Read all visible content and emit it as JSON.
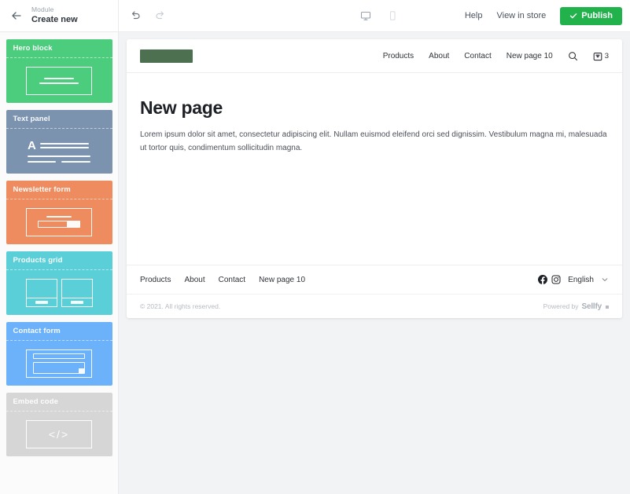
{
  "topbar": {
    "back_icon": "arrow-left-icon",
    "module_kicker": "Module",
    "module_title": "Create new",
    "undo_icon": "undo-icon",
    "redo_icon": "redo-icon",
    "desktop_view_icon": "desktop-monitor-icon",
    "mobile_view_icon": "mobile-phone-icon",
    "help_label": "Help",
    "view_in_store_label": "View in store",
    "publish_label": "Publish",
    "publish_check_icon": "check-icon",
    "publish_color": "#22b24c"
  },
  "sidebar": {
    "blocks": [
      {
        "label": "Hero block",
        "color": "#4ccd7d",
        "thumb": "hero-thumb"
      },
      {
        "label": "Text panel",
        "color": "#7c93b0",
        "thumb": "text-thumb"
      },
      {
        "label": "Newsletter form",
        "color": "#ef8c5f",
        "thumb": "newsletter-thumb"
      },
      {
        "label": "Products grid",
        "color": "#5bcfd8",
        "thumb": "products-thumb"
      },
      {
        "label": "Contact form",
        "color": "#6cb2fb",
        "thumb": "contact-thumb"
      },
      {
        "label": "Embed code",
        "color": "#d6d6d6",
        "thumb": "embed-thumb",
        "code_glyph": "</>"
      }
    ]
  },
  "preview": {
    "header": {
      "logo": "logo-placeholder",
      "logo_color": "#4d7050",
      "nav": [
        "Products",
        "About",
        "Contact",
        "New page 10"
      ],
      "search_icon": "search-icon",
      "cart_icon": "shopping-bag-icon",
      "cart_count": "3"
    },
    "main": {
      "title": "New page",
      "body": "Lorem ipsum dolor sit amet, consectetur adipiscing elit. Nullam euismod eleifend orci sed dignissim. Vestibulum magna mi, malesuada ut tortor quis, condimentum sollicitudin magna."
    },
    "footer": {
      "nav": [
        "Products",
        "About",
        "Contact",
        "New page 10"
      ],
      "facebook_icon": "facebook-icon",
      "instagram_icon": "instagram-icon",
      "language": "English",
      "chevron_icon": "chevron-down-icon"
    },
    "copyright": {
      "text": "© 2021. All rights reserved.",
      "powered_by": "Powered by",
      "brand": "Sellfy"
    }
  }
}
